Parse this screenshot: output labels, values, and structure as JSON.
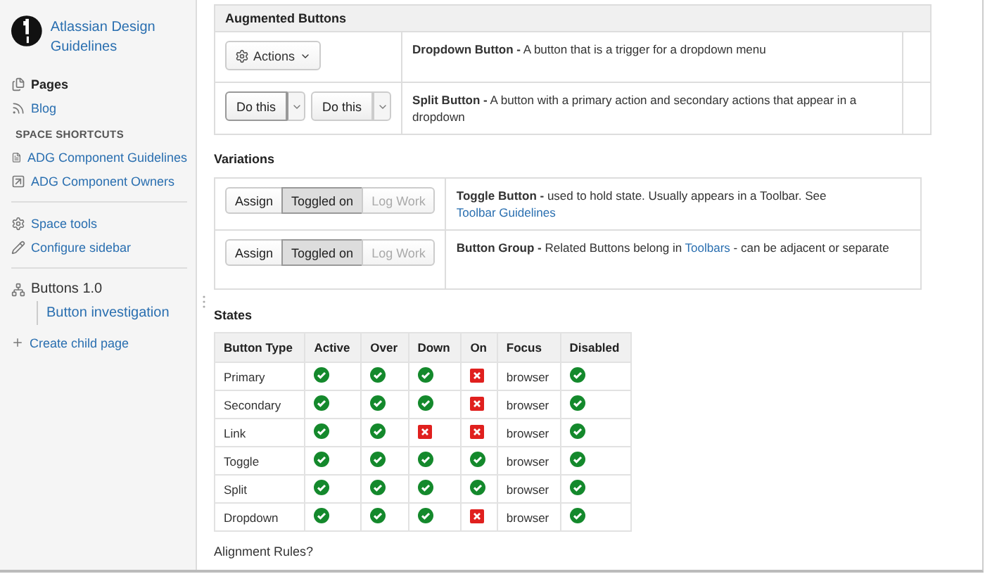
{
  "sidebar": {
    "space_title": "Atlassian Design Guidelines",
    "nav": [
      {
        "label": "Pages",
        "kind": "pages",
        "selected": true
      },
      {
        "label": "Blog",
        "kind": "blog",
        "selected": false
      }
    ],
    "shortcuts_heading": "SPACE SHORTCUTS",
    "shortcuts": [
      {
        "label": "ADG Component Guidelines",
        "kind": "page"
      },
      {
        "label": "ADG Component Owners",
        "kind": "link"
      }
    ],
    "tools": [
      {
        "label": "Space tools",
        "kind": "gear"
      },
      {
        "label": "Configure sidebar",
        "kind": "pencil"
      }
    ],
    "tree": {
      "label": "Buttons 1.0",
      "children": [
        {
          "label": "Button investigation"
        }
      ]
    },
    "create": "Create child page"
  },
  "augmented": {
    "heading": "Augmented Buttons",
    "rows": [
      {
        "kind": "dropdown",
        "buttons": [
          "Actions"
        ],
        "description": [
          {
            "kind": "bold",
            "text": "Dropdown Button -"
          },
          {
            "kind": "plain",
            "text": " A button that is a trigger for a dropdown menu"
          }
        ]
      },
      {
        "kind": "split",
        "buttons": [
          "Do this",
          "Do this"
        ],
        "description": [
          {
            "kind": "bold",
            "text": "Split Button -"
          },
          {
            "kind": "plain",
            "text": " A button with a primary action and secondary actions that appear in a dropdown"
          }
        ]
      }
    ]
  },
  "variations": {
    "heading": "Variations",
    "rows": [
      {
        "buttons": [
          {
            "label": "Assign",
            "selected": false,
            "disabled": false
          },
          {
            "label": "Toggled on",
            "selected": true,
            "disabled": false
          },
          {
            "label": "Log Work",
            "selected": false,
            "disabled": true
          }
        ],
        "description": [
          {
            "kind": "bold",
            "text": "Toggle Button -"
          },
          {
            "kind": "plain",
            "text": " used to hold state. Usually appears in a Toolbar. See "
          },
          {
            "kind": "link",
            "text": "Toolbar Guidelines"
          }
        ]
      },
      {
        "buttons": [
          {
            "label": "Assign",
            "selected": false,
            "disabled": false
          },
          {
            "label": "Toggled on",
            "selected": true,
            "disabled": false
          },
          {
            "label": "Log Work",
            "selected": false,
            "disabled": true
          }
        ],
        "description": [
          {
            "kind": "bold",
            "text": "Button Group -"
          },
          {
            "kind": "plain",
            "text": " Related Buttons belong in "
          },
          {
            "kind": "link",
            "text": "Toolbars"
          },
          {
            "kind": "plain",
            "text": " - can be adjacent or separate"
          }
        ]
      }
    ]
  },
  "states": {
    "heading": "States",
    "columns": [
      "Button Type",
      "Active",
      "Over",
      "Down",
      "On",
      "Focus",
      "Disabled"
    ],
    "rows": [
      {
        "type": "Primary",
        "active": true,
        "over": true,
        "down": true,
        "on": false,
        "focus": "browser",
        "disabled": true
      },
      {
        "type": "Secondary",
        "active": true,
        "over": true,
        "down": true,
        "on": false,
        "focus": "browser",
        "disabled": true
      },
      {
        "type": "Link",
        "active": true,
        "over": true,
        "down": false,
        "on": false,
        "focus": "browser",
        "disabled": true
      },
      {
        "type": "Toggle",
        "active": true,
        "over": true,
        "down": true,
        "on": true,
        "focus": "browser",
        "disabled": true
      },
      {
        "type": "Split",
        "active": true,
        "over": true,
        "down": true,
        "on": true,
        "focus": "browser",
        "disabled": true
      },
      {
        "type": "Dropdown",
        "active": true,
        "over": true,
        "down": true,
        "on": false,
        "focus": "browser",
        "disabled": true
      }
    ]
  },
  "next_heading": "Alignment Rules?"
}
